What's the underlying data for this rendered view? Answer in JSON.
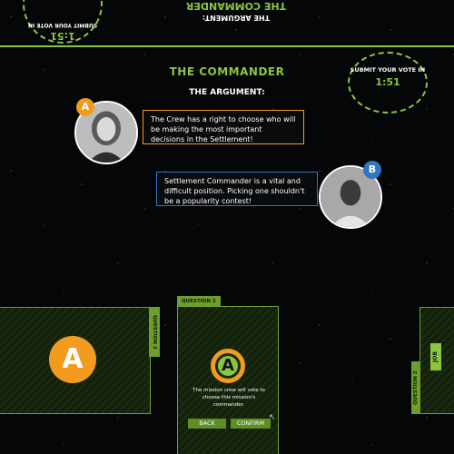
{
  "header": {
    "title": "THE COMMANDER",
    "subtitle": "THE ARGUMENT:",
    "timer_label": "SUBMIT YOUR VOTE IN",
    "timer_value": "1:51"
  },
  "top_mirror": {
    "title": "THE COMMANDER",
    "subtitle": "THE ARGUMENT:",
    "timer_label": "SUBMIT YOUR VOTE IN",
    "timer_value": "1:51"
  },
  "arguments": [
    {
      "badge": "A",
      "text": "The Crew has a right to choose who will be making the most important decisions in the Settlement!",
      "color": "#f29b1f"
    },
    {
      "badge": "B",
      "text": "Settlement Commander is a vital and difficult position. Picking one shouldn't be a popularity contest!",
      "color": "#2f76c4"
    }
  ],
  "cards": {
    "left": {
      "tab_label": "QUESTION 2",
      "badge": "A"
    },
    "main": {
      "tab_label": "QUESTION 2",
      "choice": "A",
      "description": "The mission crew will vote to choose this mission's commander.",
      "back_label": "BACK",
      "confirm_label": "CONFIRM"
    },
    "right": {
      "tab_label": "QUESTION 2",
      "side_label": "JOB"
    }
  },
  "colors": {
    "accent_green": "#8bc63f",
    "orange": "#f29b1f",
    "blue": "#2f76c4"
  }
}
